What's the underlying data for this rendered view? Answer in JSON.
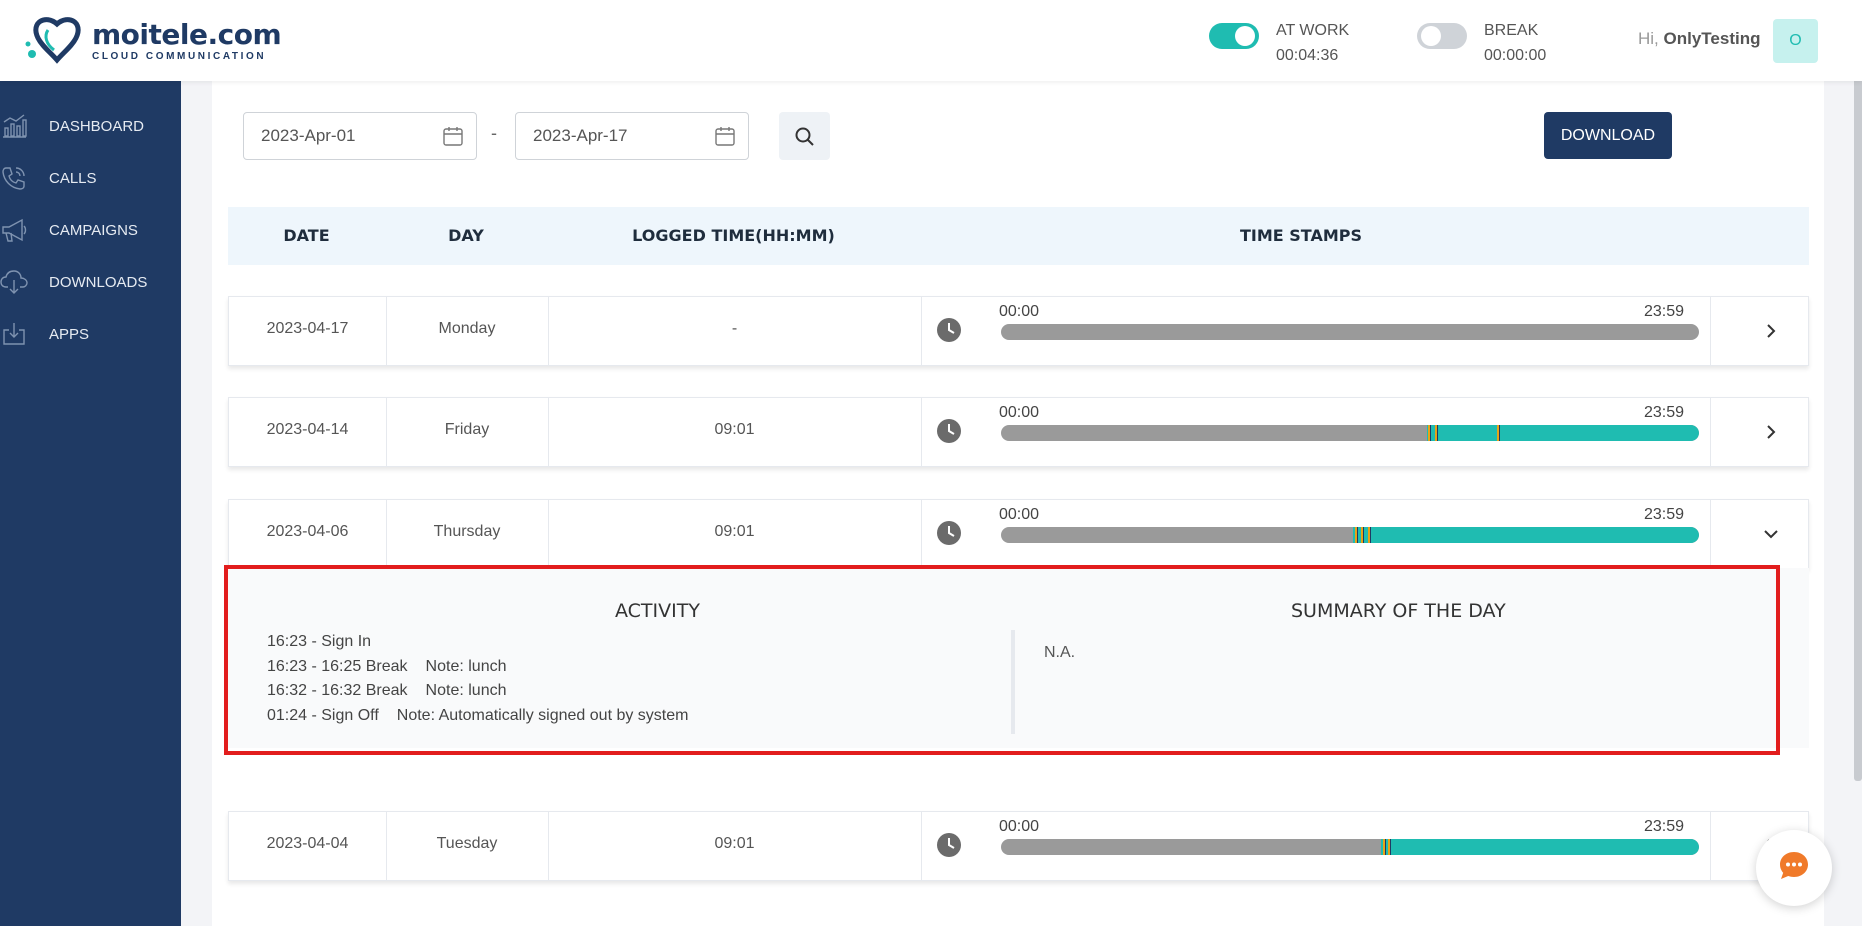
{
  "brand": {
    "name": "moitele.com",
    "tagline": "CLOUD COMMUNICATION"
  },
  "status": {
    "at_work": {
      "label": "AT WORK",
      "time": "00:04:36",
      "on": true
    },
    "break": {
      "label": "BREAK",
      "time": "00:00:00",
      "on": false
    }
  },
  "user": {
    "greeting": "Hi,",
    "name": "OnlyTesting",
    "initial": "O"
  },
  "sidebar": {
    "items": [
      {
        "label": "DASHBOARD",
        "icon": "chart-icon"
      },
      {
        "label": "CALLS",
        "icon": "phone-icon"
      },
      {
        "label": "CAMPAIGNS",
        "icon": "megaphone-icon"
      },
      {
        "label": "DOWNLOADS",
        "icon": "cloud-download-icon"
      },
      {
        "label": "APPS",
        "icon": "tray-download-icon"
      }
    ]
  },
  "filters": {
    "from": "2023-Apr-01",
    "separator": "-",
    "to": "2023-Apr-17",
    "download_label": "DOWNLOAD"
  },
  "table": {
    "columns": [
      "DATE",
      "DAY",
      "LOGGED TIME(HH:MM)",
      "TIME STAMPS"
    ],
    "timeline_start": "00:00",
    "timeline_end": "23:59",
    "rows": [
      {
        "date": "2023-04-17",
        "day": "Monday",
        "logged": "-",
        "worked_from": null,
        "breaks": [],
        "expanded": false
      },
      {
        "date": "2023-04-14",
        "day": "Friday",
        "logged": "09:01",
        "worked_from": 0.61,
        "breaks": [
          0.612,
          0.622,
          0.71
        ],
        "expanded": false
      },
      {
        "date": "2023-04-06",
        "day": "Thursday",
        "logged": "09:01",
        "worked_from": 0.505,
        "breaks": [
          0.507,
          0.516,
          0.526
        ],
        "expanded": true
      },
      {
        "date": "2023-04-04",
        "day": "Tuesday",
        "logged": "09:01",
        "worked_from": 0.545,
        "breaks": [
          0.547,
          0.555
        ],
        "expanded": false
      }
    ]
  },
  "expanded": {
    "activity_title": "ACTIVITY",
    "summary_title": "SUMMARY OF THE DAY",
    "activities": [
      {
        "time": "16:23 -  Sign In",
        "note": ""
      },
      {
        "time": "16:23 - 16:25 Break",
        "note": "Note:  lunch"
      },
      {
        "time": "16:32 - 16:32 Break",
        "note": "Note:  lunch"
      },
      {
        "time": "01:24 -  Sign Off",
        "note": "Note:  Automatically signed out by system"
      }
    ],
    "summary": "N.A."
  },
  "colors": {
    "brand": "#1f3a64",
    "accent": "#1fbcb1",
    "idle": "#9a9a9a",
    "break_mark": "#e8a317",
    "highlight": "#e21d1d"
  }
}
